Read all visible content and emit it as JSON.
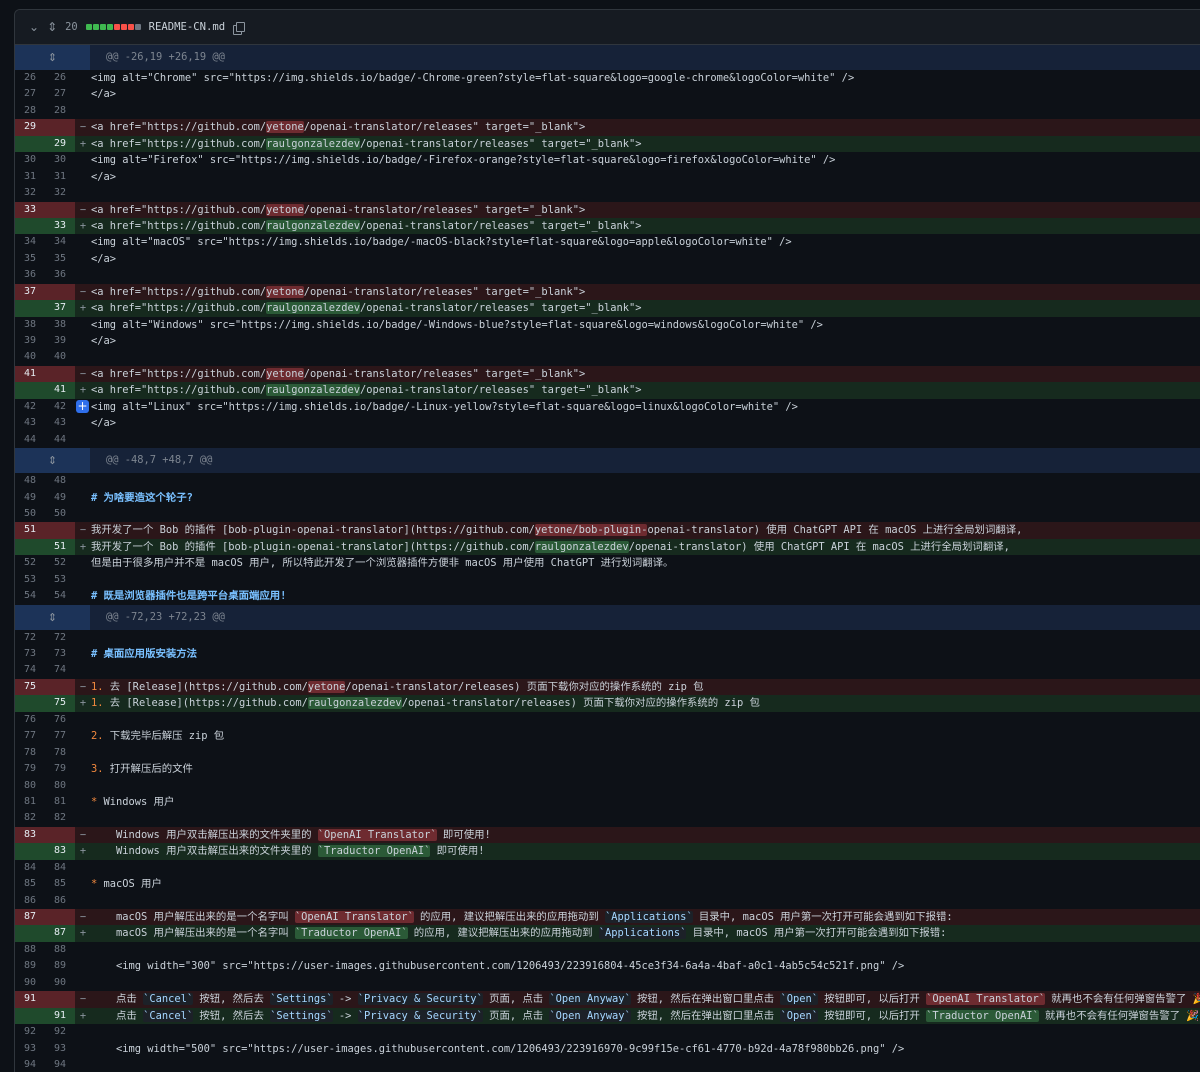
{
  "file": {
    "count": "20",
    "name": "README-CN.md",
    "diffstat": [
      "#3fb950",
      "#3fb950",
      "#3fb950",
      "#3fb950",
      "#f85149",
      "#f85149",
      "#f85149",
      "#6e7681"
    ]
  },
  "rows": [
    {
      "t": "hunk",
      "text": "@@ -26,19 +26,19 @@"
    },
    {
      "t": "ctx",
      "o": "26",
      "n": "26",
      "parts": [
        [
          "<img alt=\"Chrome\" src=\"https://img.shields.io/badge/-Chrome-green?style=flat-square&logo=google-chrome&logoColor=white\" />"
        ]
      ]
    },
    {
      "t": "ctx",
      "o": "27",
      "n": "27",
      "parts": [
        [
          "</a>"
        ]
      ]
    },
    {
      "t": "ctx",
      "o": "28",
      "n": "28",
      "parts": [
        [
          ""
        ]
      ]
    },
    {
      "t": "del",
      "o": "29",
      "n": "",
      "parts": [
        [
          "<a href=\"https://github.com/"
        ],
        [
          "yetone",
          "hl-del"
        ],
        [
          "/openai-translator/releases\" target=\"_blank\">"
        ]
      ]
    },
    {
      "t": "add",
      "o": "",
      "n": "29",
      "parts": [
        [
          "<a href=\"https://github.com/"
        ],
        [
          "raulgonzalezdev",
          "hl-add"
        ],
        [
          "/openai-translator/releases\" target=\"_blank\">"
        ]
      ]
    },
    {
      "t": "ctx",
      "o": "30",
      "n": "30",
      "parts": [
        [
          "<img alt=\"Firefox\" src=\"https://img.shields.io/badge/-Firefox-orange?style=flat-square&logo=firefox&logoColor=white\" />"
        ]
      ]
    },
    {
      "t": "ctx",
      "o": "31",
      "n": "31",
      "parts": [
        [
          "</a>"
        ]
      ]
    },
    {
      "t": "ctx",
      "o": "32",
      "n": "32",
      "parts": [
        [
          ""
        ]
      ]
    },
    {
      "t": "del",
      "o": "33",
      "n": "",
      "parts": [
        [
          "<a href=\"https://github.com/"
        ],
        [
          "yetone",
          "hl-del"
        ],
        [
          "/openai-translator/releases\" target=\"_blank\">"
        ]
      ]
    },
    {
      "t": "add",
      "o": "",
      "n": "33",
      "parts": [
        [
          "<a href=\"https://github.com/"
        ],
        [
          "raulgonzalezdev",
          "hl-add"
        ],
        [
          "/openai-translator/releases\" target=\"_blank\">"
        ]
      ]
    },
    {
      "t": "ctx",
      "o": "34",
      "n": "34",
      "parts": [
        [
          "<img alt=\"macOS\" src=\"https://img.shields.io/badge/-macOS-black?style=flat-square&logo=apple&logoColor=white\" />"
        ]
      ]
    },
    {
      "t": "ctx",
      "o": "35",
      "n": "35",
      "parts": [
        [
          "</a>"
        ]
      ]
    },
    {
      "t": "ctx",
      "o": "36",
      "n": "36",
      "parts": [
        [
          ""
        ]
      ]
    },
    {
      "t": "del",
      "o": "37",
      "n": "",
      "parts": [
        [
          "<a href=\"https://github.com/"
        ],
        [
          "yetone",
          "hl-del"
        ],
        [
          "/openai-translator/releases\" target=\"_blank\">"
        ]
      ]
    },
    {
      "t": "add",
      "o": "",
      "n": "37",
      "parts": [
        [
          "<a href=\"https://github.com/"
        ],
        [
          "raulgonzalezdev",
          "hl-add"
        ],
        [
          "/openai-translator/releases\" target=\"_blank\">"
        ]
      ]
    },
    {
      "t": "ctx",
      "o": "38",
      "n": "38",
      "parts": [
        [
          "<img alt=\"Windows\" src=\"https://img.shields.io/badge/-Windows-blue?style=flat-square&logo=windows&logoColor=white\" />"
        ]
      ]
    },
    {
      "t": "ctx",
      "o": "39",
      "n": "39",
      "parts": [
        [
          "</a>"
        ]
      ]
    },
    {
      "t": "ctx",
      "o": "40",
      "n": "40",
      "parts": [
        [
          ""
        ]
      ]
    },
    {
      "t": "del",
      "o": "41",
      "n": "",
      "parts": [
        [
          "<a href=\"https://github.com/"
        ],
        [
          "yetone",
          "hl-del"
        ],
        [
          "/openai-translator/releases\" target=\"_blank\">"
        ]
      ]
    },
    {
      "t": "add",
      "o": "",
      "n": "41",
      "parts": [
        [
          "<a href=\"https://github.com/"
        ],
        [
          "raulgonzalezdev",
          "hl-add"
        ],
        [
          "/openai-translator/releases\" target=\"_blank\">"
        ]
      ]
    },
    {
      "t": "ctx",
      "o": "42",
      "n": "42",
      "plus": true,
      "parts": [
        [
          "<img alt=\"Linux\" src=\"https://img.shields.io/badge/-Linux-yellow?style=flat-square&logo=linux&logoColor=white\" />"
        ]
      ]
    },
    {
      "t": "ctx",
      "o": "43",
      "n": "43",
      "parts": [
        [
          "</a>"
        ]
      ]
    },
    {
      "t": "ctx",
      "o": "44",
      "n": "44",
      "parts": [
        [
          ""
        ]
      ]
    },
    {
      "t": "hunk",
      "text": "@@ -48,7 +48,7 @@"
    },
    {
      "t": "ctx",
      "o": "48",
      "n": "48",
      "parts": [
        [
          ""
        ]
      ]
    },
    {
      "t": "ctx",
      "o": "49",
      "n": "49",
      "parts": [
        [
          "# 为啥要造这个轮子?",
          "hd"
        ]
      ]
    },
    {
      "t": "ctx",
      "o": "50",
      "n": "50",
      "parts": [
        [
          ""
        ]
      ]
    },
    {
      "t": "del",
      "o": "51",
      "n": "",
      "parts": [
        [
          "我开发了一个 Bob 的插件 [bob-plugin-openai-translator](https://github.com/"
        ],
        [
          "yetone/bob-plugin-",
          "hl-del"
        ],
        [
          "openai-translator) 使用 ChatGPT API 在 macOS 上进行全局划词翻译,"
        ]
      ]
    },
    {
      "t": "add",
      "o": "",
      "n": "51",
      "parts": [
        [
          "我开发了一个 Bob 的插件 [bob-plugin-openai-translator](https://github.com/"
        ],
        [
          "raulgonzalezdev",
          "hl-add"
        ],
        [
          "/openai-translator) 使用 ChatGPT API 在 macOS 上进行全局划词翻译,"
        ]
      ]
    },
    {
      "t": "ctx",
      "o": "52",
      "n": "52",
      "parts": [
        [
          "但是由于很多用户并不是 macOS 用户, 所以特此开发了一个浏览器插件方便非 macOS 用户使用 ChatGPT 进行划词翻译。"
        ]
      ]
    },
    {
      "t": "ctx",
      "o": "53",
      "n": "53",
      "parts": [
        [
          ""
        ]
      ]
    },
    {
      "t": "ctx",
      "o": "54",
      "n": "54",
      "parts": [
        [
          "# 既是浏览器插件也是跨平台桌面端应用!",
          "hd"
        ]
      ]
    },
    {
      "t": "hunk",
      "text": "@@ -72,23 +72,23 @@"
    },
    {
      "t": "ctx",
      "o": "72",
      "n": "72",
      "parts": [
        [
          ""
        ]
      ]
    },
    {
      "t": "ctx",
      "o": "73",
      "n": "73",
      "parts": [
        [
          "# 桌面应用版安装方法",
          "hd"
        ]
      ]
    },
    {
      "t": "ctx",
      "o": "74",
      "n": "74",
      "parts": [
        [
          ""
        ]
      ]
    },
    {
      "t": "del",
      "o": "75",
      "n": "",
      "parts": [
        [
          "1. ",
          "blt"
        ],
        [
          "去 [Release](https://github.com/"
        ],
        [
          "yetone",
          "hl-del"
        ],
        [
          "/openai-translator/releases) 页面下载你对应的操作系统的 zip 包"
        ]
      ]
    },
    {
      "t": "add",
      "o": "",
      "n": "75",
      "parts": [
        [
          "1. ",
          "blt"
        ],
        [
          "去 [Release](https://github.com/"
        ],
        [
          "raulgonzalezdev",
          "hl-add"
        ],
        [
          "/openai-translator/releases) 页面下载你对应的操作系统的 zip 包"
        ]
      ]
    },
    {
      "t": "ctx",
      "o": "76",
      "n": "76",
      "parts": [
        [
          ""
        ]
      ]
    },
    {
      "t": "ctx",
      "o": "77",
      "n": "77",
      "parts": [
        [
          "2. ",
          "blt"
        ],
        [
          "下载完毕后解压 zip 包"
        ]
      ]
    },
    {
      "t": "ctx",
      "o": "78",
      "n": "78",
      "parts": [
        [
          ""
        ]
      ]
    },
    {
      "t": "ctx",
      "o": "79",
      "n": "79",
      "parts": [
        [
          "3. ",
          "blt"
        ],
        [
          "打开解压后的文件"
        ]
      ]
    },
    {
      "t": "ctx",
      "o": "80",
      "n": "80",
      "parts": [
        [
          ""
        ]
      ]
    },
    {
      "t": "ctx",
      "o": "81",
      "n": "81",
      "parts": [
        [
          "* ",
          "blt"
        ],
        [
          "Windows 用户"
        ]
      ]
    },
    {
      "t": "ctx",
      "o": "82",
      "n": "82",
      "parts": [
        [
          ""
        ]
      ]
    },
    {
      "t": "del",
      "o": "83",
      "n": "",
      "parts": [
        [
          "    Windows 用户双击解压出来的文件夹里的 "
        ],
        [
          "`OpenAI Translator`",
          "hl-del"
        ],
        [
          " 即可使用!"
        ]
      ]
    },
    {
      "t": "add",
      "o": "",
      "n": "83",
      "parts": [
        [
          "    Windows 用户双击解压出来的文件夹里的 "
        ],
        [
          "`Traductor OpenAI`",
          "hl-add"
        ],
        [
          " 即可使用!"
        ]
      ]
    },
    {
      "t": "ctx",
      "o": "84",
      "n": "84",
      "parts": [
        [
          ""
        ]
      ]
    },
    {
      "t": "ctx",
      "o": "85",
      "n": "85",
      "parts": [
        [
          "* ",
          "blt"
        ],
        [
          "macOS 用户"
        ]
      ]
    },
    {
      "t": "ctx",
      "o": "86",
      "n": "86",
      "parts": [
        [
          ""
        ]
      ]
    },
    {
      "t": "del",
      "o": "87",
      "n": "",
      "parts": [
        [
          "    macOS 用户解压出来的是一个名字叫 "
        ],
        [
          "`OpenAI Translator`",
          "hl-del"
        ],
        [
          " 的应用, 建议把解压出来的应用拖动到 "
        ],
        [
          "`Applications`",
          "cd"
        ],
        [
          " 目录中, macOS 用户第一次打开可能会遇到如下报错:"
        ]
      ]
    },
    {
      "t": "add",
      "o": "",
      "n": "87",
      "parts": [
        [
          "    macOS 用户解压出来的是一个名字叫 "
        ],
        [
          "`Traductor OpenAI`",
          "hl-add"
        ],
        [
          " 的应用, 建议把解压出来的应用拖动到 "
        ],
        [
          "`Applications`",
          "cd"
        ],
        [
          " 目录中, macOS 用户第一次打开可能会遇到如下报错:"
        ]
      ]
    },
    {
      "t": "ctx",
      "o": "88",
      "n": "88",
      "parts": [
        [
          ""
        ]
      ]
    },
    {
      "t": "ctx",
      "o": "89",
      "n": "89",
      "parts": [
        [
          "    <img width=\"300\" src=\"https://user-images.githubusercontent.com/1206493/223916804-45ce3f34-6a4a-4baf-a0c1-4ab5c54c521f.png\" />"
        ]
      ]
    },
    {
      "t": "ctx",
      "o": "90",
      "n": "90",
      "parts": [
        [
          ""
        ]
      ]
    },
    {
      "t": "del",
      "o": "91",
      "n": "",
      "parts": [
        [
          "    点击 "
        ],
        [
          "`Cancel`",
          "cd"
        ],
        [
          " 按钮, 然后去 "
        ],
        [
          "`Settings`",
          "cd"
        ],
        [
          " -> "
        ],
        [
          "`Privacy & Security`",
          "cd"
        ],
        [
          " 页面, 点击 "
        ],
        [
          "`Open Anyway`",
          "cd"
        ],
        [
          " 按钮, 然后在弹出窗口里点击 "
        ],
        [
          "`Open`",
          "cd"
        ],
        [
          " 按钮即可, 以后打开 "
        ],
        [
          "`OpenAI Translator`",
          "hl-del"
        ],
        [
          " 就再也不会有任何弹窗告警了 🎉"
        ]
      ]
    },
    {
      "t": "add",
      "o": "",
      "n": "91",
      "parts": [
        [
          "    点击 "
        ],
        [
          "`Cancel`",
          "cd"
        ],
        [
          " 按钮, 然后去 "
        ],
        [
          "`Settings`",
          "cd"
        ],
        [
          " -> "
        ],
        [
          "`Privacy & Security`",
          "cd"
        ],
        [
          " 页面, 点击 "
        ],
        [
          "`Open Anyway`",
          "cd"
        ],
        [
          " 按钮, 然后在弹出窗口里点击 "
        ],
        [
          "`Open`",
          "cd"
        ],
        [
          " 按钮即可, 以后打开 "
        ],
        [
          "`Traductor OpenAI`",
          "hl-add"
        ],
        [
          " 就再也不会有任何弹窗告警了 🎉"
        ]
      ]
    },
    {
      "t": "ctx",
      "o": "92",
      "n": "92",
      "parts": [
        [
          ""
        ]
      ]
    },
    {
      "t": "ctx",
      "o": "93",
      "n": "93",
      "parts": [
        [
          "    <img width=\"500\" src=\"https://user-images.githubusercontent.com/1206493/223916970-9c99f15e-cf61-4770-b92d-4a78f980bb26.png\" />"
        ]
      ]
    },
    {
      "t": "ctx",
      "o": "94",
      "n": "94",
      "parts": [
        [
          ""
        ]
      ]
    }
  ]
}
